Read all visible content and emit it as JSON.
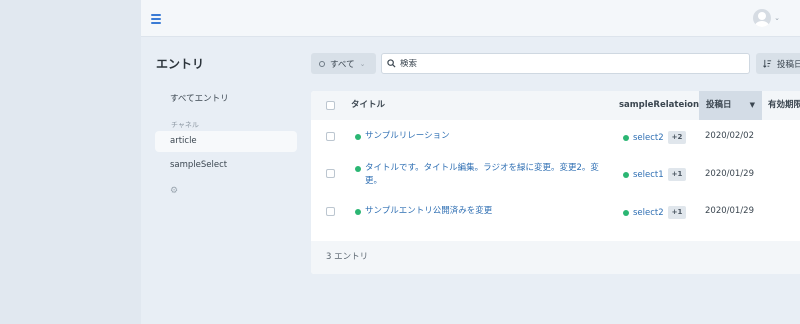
{
  "colors": {
    "accent": "#2f6fb3",
    "status_published": "#2bb673",
    "background": "#e8eef5"
  },
  "header": {
    "menu_icon": "hamburger-icon",
    "avatar_icon": "user-avatar-icon"
  },
  "sidebar": {
    "title": "エントリ",
    "all_entries_label": "すべてエントリ",
    "channel_heading": "チャネル",
    "channels": [
      {
        "label": "article",
        "active": true
      },
      {
        "label": "sampleSelect",
        "active": false
      }
    ],
    "settings_icon": "gear-icon"
  },
  "toolbar": {
    "filter_label": "すべて",
    "search_placeholder": "検索",
    "sort_label": "投稿日"
  },
  "table": {
    "columns": {
      "title": "タイトル",
      "relation": "sampleRelateion",
      "posted": "投稿日",
      "expiry": "有効期限"
    },
    "rows": [
      {
        "title": "サンプルリレーション",
        "relation": "select2",
        "relation_more": "+2",
        "posted": "2020/02/02"
      },
      {
        "title": "タイトルです。タイトル編集。ラジオを緑に変更。変更2。変更。",
        "relation": "select1",
        "relation_more": "+1",
        "posted": "2020/01/29"
      },
      {
        "title": "サンプルエントリ公開済みを変更",
        "relation": "select2",
        "relation_more": "+1",
        "posted": "2020/01/29"
      }
    ],
    "footer_count": "3 エントリ"
  }
}
